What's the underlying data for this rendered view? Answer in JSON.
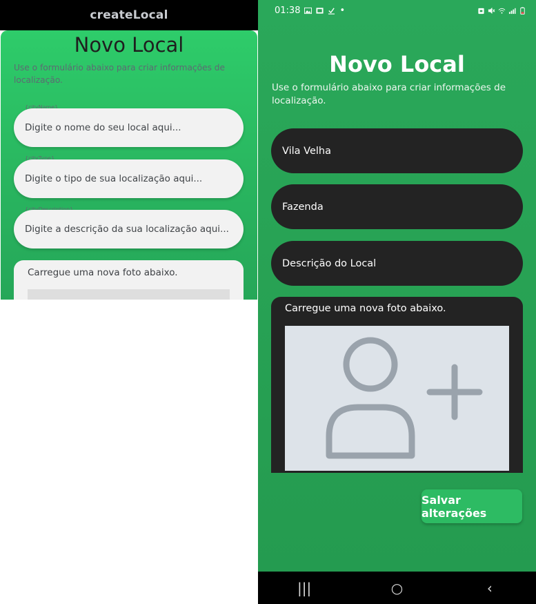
{
  "preview": {
    "app_title": "createLocal",
    "heading": "Novo Local",
    "subtitle": "Use o formulário abaixo para criar informações de localização.",
    "fields": [
      {
        "caption": "{cityName}",
        "placeholder": "Digite o nome do seu local aqui..."
      },
      {
        "caption": "{cityType}",
        "placeholder": "Digite o tipo de sua localização aqui..."
      },
      {
        "caption": "{cityDescription}",
        "placeholder": "Digite a descrição da sua localização aqui..."
      }
    ],
    "photo_label": "Carregue uma nova foto abaixo."
  },
  "phone": {
    "status": {
      "time": "01:38",
      "dot": "•"
    },
    "heading": "Novo Local",
    "subtitle": "Use o formulário abaixo para criar informações de localização.",
    "fields": [
      {
        "value": "Vila Velha"
      },
      {
        "value": "Fazenda"
      },
      {
        "value": "Descrição do Local"
      }
    ],
    "photo_label": "Carregue uma nova foto abaixo.",
    "save_label": "Salvar alterações",
    "nav": {
      "recents": "|||",
      "home": "○",
      "back": "‹"
    }
  },
  "colors": {
    "accent_green": "#2dbb63",
    "field_dark": "#232323",
    "preview_green": "#2ecc6a"
  },
  "icons": [
    "add-user-icon",
    "image-icon",
    "download-icon",
    "wifi-icon",
    "signal-icon",
    "battery-icon"
  ]
}
